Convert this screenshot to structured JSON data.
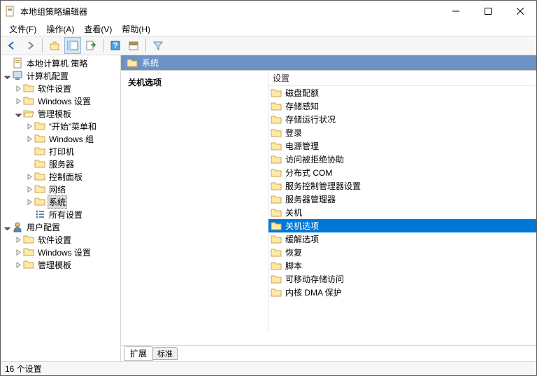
{
  "window": {
    "title": "本地组策略编辑器"
  },
  "menu": {
    "file": "文件(F)",
    "action": "操作(A)",
    "view": "查看(V)",
    "help": "帮助(H)"
  },
  "tree": {
    "root": "本地计算机 策略",
    "computer_cfg": "计算机配置",
    "software_settings": "软件设置",
    "windows_settings": "Windows 设置",
    "admin_templates": "管理模板",
    "start_menu": "“开始”菜单和",
    "windows_components": "Windows 组",
    "printers": "打印机",
    "servers": "服务器",
    "control_panel": "控制面板",
    "network": "网络",
    "system": "系统",
    "all_settings": "所有设置",
    "user_cfg": "用户配置",
    "u_software_settings": "软件设置",
    "u_windows_settings": "Windows 设置",
    "u_admin_templates": "管理模板"
  },
  "path": {
    "label": "系统"
  },
  "desc": {
    "title": "关机选项"
  },
  "list": {
    "header": "设置",
    "items": [
      "磁盘配额",
      "存储感知",
      "存储运行状况",
      "登录",
      "电源管理",
      "访问被拒绝协助",
      "分布式 COM",
      "服务控制管理器设置",
      "服务器管理器",
      "关机",
      "关机选项",
      "缓解选项",
      "恢复",
      "脚本",
      "可移动存储访问",
      "内核 DMA 保护"
    ],
    "selected_index": 10
  },
  "tabs": {
    "extended": "扩展",
    "standard": "标准"
  },
  "status": {
    "text": "16 个设置"
  }
}
